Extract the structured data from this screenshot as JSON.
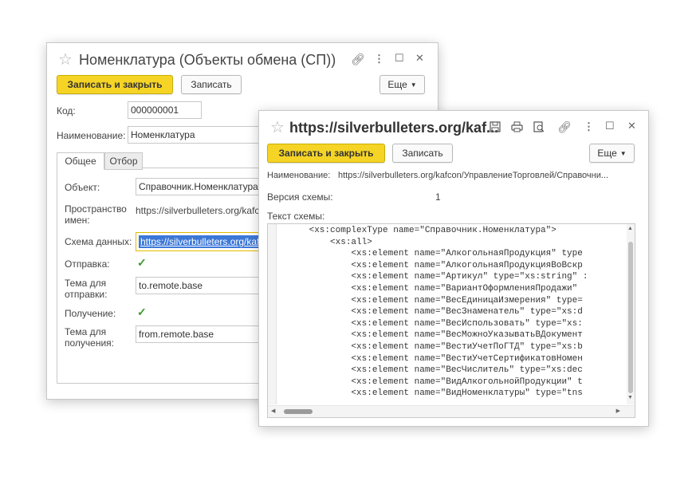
{
  "w1": {
    "title": "Номенклатура (Объекты обмена (СП))",
    "btn_save_close": "Записать и закрыть",
    "btn_save": "Записать",
    "btn_more": "Еще",
    "code_label": "Код:",
    "code_value": "000000001",
    "name_label": "Наименование:",
    "name_value": "Номенклатура",
    "tab_general": "Общее",
    "tab_filter": "Отбор",
    "object_label": "Объект:",
    "object_value": "Справочник.Номенклатура",
    "namespace_label_1": "Пространство",
    "namespace_label_2": "имен:",
    "namespace_value": "https://silverbulleters.org/kafcon/УправлениеТорговлей/Справочник",
    "schema_label": "Схема данных:",
    "schema_value": "https://silverbulleters.org/kafcon",
    "send_label": "Отправка:",
    "send_topic_label_1": "Тема для",
    "send_topic_label_2": "отправки:",
    "send_topic_value": "to.remote.base",
    "receive_label": "Получение:",
    "receive_topic_label_1": "Тема для",
    "receive_topic_label_2": "получения:",
    "receive_topic_value": "from.remote.base"
  },
  "w2": {
    "title": "https://silverbulleters.org/kaf...",
    "btn_save_close": "Записать и закрыть",
    "btn_save": "Записать",
    "btn_more": "Еще",
    "name_label": "Наименование:",
    "name_value": "https://silverbulleters.org/kafcon/УправлениеТорговлей/Справочни...",
    "version_label": "Версия схемы:",
    "version_value": "1",
    "schema_text_label": "Текст схемы:",
    "code_lines": [
      "      <xs:complexType name=\"Справочник.Номенклатура\">",
      "          <xs:all>",
      "              <xs:element name=\"АлкогольнаяПродукция\" type",
      "              <xs:element name=\"АлкогольнаяПродукцияВоВскр",
      "              <xs:element name=\"Артикул\" type=\"xs:string\" :",
      "              <xs:element name=\"ВариантОформленияПродажи\"",
      "              <xs:element name=\"ВесЕдиницаИзмерения\" type=",
      "              <xs:element name=\"ВесЗнаменатель\" type=\"xs:d",
      "              <xs:element name=\"ВесИспользовать\" type=\"xs:",
      "              <xs:element name=\"ВесМожноУказыватьВДокумент",
      "              <xs:element name=\"ВестиУчетПоГТД\" type=\"xs:b",
      "              <xs:element name=\"ВестиУчетСертификатовНомен",
      "              <xs:element name=\"ВесЧислитель\" type=\"xs:dec",
      "              <xs:element name=\"ВидАлкогольнойПродукции\" t",
      "              <xs:element name=\"ВидНоменклатуры\" type=\"tns"
    ]
  },
  "colors": {
    "accent_yellow": "#f5d426",
    "selection_blue": "#3c78d8",
    "check_green": "#3a9a2a"
  },
  "icons": [
    "star-icon",
    "link-icon",
    "more-vert-icon",
    "maximize-icon",
    "close-icon",
    "save-icon",
    "print-icon",
    "preview-icon"
  ]
}
